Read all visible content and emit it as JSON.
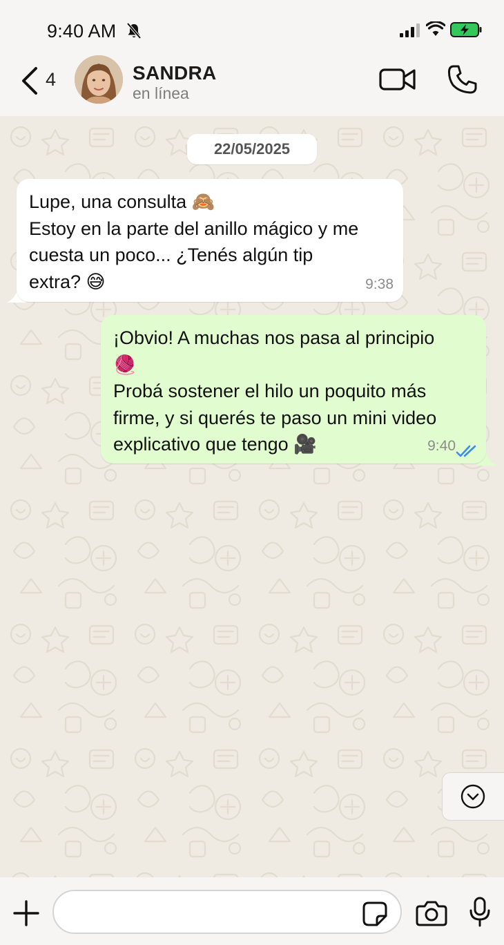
{
  "status_bar": {
    "time": "9:40 AM",
    "icons": [
      "bell-slash-icon",
      "signal-icon",
      "wifi-icon",
      "battery-charging-icon"
    ]
  },
  "header": {
    "back_count": "4",
    "contact_name": "SANDRA",
    "contact_status": "en línea",
    "icons": [
      "chevron-left-icon",
      "video-call-icon",
      "phone-call-icon"
    ]
  },
  "chat": {
    "date_chip": "22/05/2025",
    "messages": [
      {
        "direction": "incoming",
        "lines": [
          "Lupe, una consulta 🙈",
          "Estoy en la parte del anillo mágico y me",
          "cuesta un poco... ¿Tenés algún tip",
          "extra? 😅"
        ],
        "time": "9:38"
      },
      {
        "direction": "outgoing",
        "lines": [
          "¡Obvio! A muchas nos pasa al principio",
          "🧶",
          "Probá sostener el hilo un poquito más",
          "firme, y si querés te paso un mini video",
          "explicativo que tengo 🎥"
        ],
        "time": "9:40",
        "status": "read"
      }
    ]
  },
  "footer": {
    "input_value": "",
    "icons": [
      "plus-icon",
      "sticker-icon",
      "camera-icon",
      "microphone-icon"
    ]
  },
  "colors": {
    "app_bg": "#f6f5f3",
    "chat_bg": "#efeae2",
    "incoming_bubble": "#ffffff",
    "outgoing_bubble": "#e1fcce",
    "read_ticks": "#3d8af7",
    "battery_fill": "#34c759"
  }
}
